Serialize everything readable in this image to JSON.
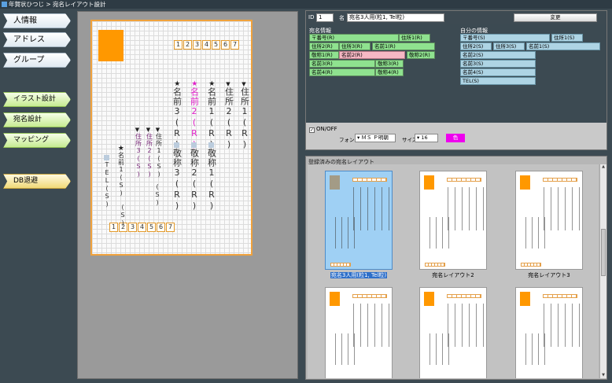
{
  "window": {
    "title": "年賀状ひつじ > 宛名レイアウト設計"
  },
  "nav": [
    {
      "label": "人情報",
      "style": "blue"
    },
    {
      "label": "アドレス",
      "style": "blue"
    },
    {
      "label": "グループ",
      "style": "blue"
    },
    {
      "label": "イラスト設計",
      "style": "green"
    },
    {
      "label": "宛名設計",
      "style": "green"
    },
    {
      "label": "マッピング",
      "style": "green"
    },
    {
      "label": "DB退避",
      "style": "yellow"
    }
  ],
  "card": {
    "postal_top": [
      "1",
      "2",
      "3",
      "4",
      "5",
      "6",
      "7"
    ],
    "postal_bottom": [
      "1",
      "2",
      "3",
      "4",
      "5",
      "6",
      "7"
    ],
    "columns_large": [
      {
        "text": "名前3(R)",
        "mark": "star"
      },
      {
        "text": "名前2(R)",
        "mark": "star-pink"
      },
      {
        "text": "名前1(R)",
        "mark": "star"
      },
      {
        "text": "住所2(R)",
        "mark": "tri"
      },
      {
        "text": "住所1(R)",
        "mark": "tri"
      }
    ],
    "columns_honor": [
      "敬称3(R)",
      "敬称2(R)",
      "敬称1(R)"
    ],
    "columns_small": [
      {
        "text": "TEL(S)",
        "mark": "sq"
      },
      {
        "text": "名前1(S)",
        "mark": "star"
      },
      {
        "text": "住所3(S)",
        "mark": "tri"
      },
      {
        "text": "住所2(S)",
        "mark": "tri"
      },
      {
        "text": "住所1(S)",
        "mark": "tri"
      }
    ],
    "small_extra": "(S)",
    "small_extra2": "(S)"
  },
  "toolbar": {
    "id_label": "ID",
    "id_value": "1",
    "name_label": "名",
    "name_value": "宛名3人用(粒1, Tel粒)",
    "change_button": "変更"
  },
  "recipient_group": {
    "title": "宛名情報",
    "fields": [
      {
        "label": "〒番号(R)",
        "style": "g"
      },
      {
        "label": "住所1(R)",
        "style": "g"
      },
      {
        "label": "住所2(R)",
        "style": "g"
      },
      {
        "label": "住所3(R)",
        "style": "g"
      },
      {
        "label": "名前1(R)",
        "style": "g"
      },
      {
        "label": "敬称1(R)",
        "style": "g"
      },
      {
        "label": "名前2(R)",
        "style": "p"
      },
      {
        "label": "敬称2(R)",
        "style": "g"
      },
      {
        "label": "名前3(R)",
        "style": "g"
      },
      {
        "label": "敬称3(R)",
        "style": "g"
      },
      {
        "label": "名前4(R)",
        "style": "g"
      },
      {
        "label": "敬称4(R)",
        "style": "g"
      }
    ]
  },
  "sender_group": {
    "title": "自分の情報",
    "fields": [
      {
        "label": "〒番号(S)",
        "style": "b"
      },
      {
        "label": "住所1(S)",
        "style": "b"
      },
      {
        "label": "住所2(S)",
        "style": "b"
      },
      {
        "label": "住所3(S)",
        "style": "b"
      },
      {
        "label": "名前1(S)",
        "style": "b"
      },
      {
        "label": "名前2(S)",
        "style": "b"
      },
      {
        "label": "名前3(S)",
        "style": "b"
      },
      {
        "label": "名前4(S)",
        "style": "b"
      },
      {
        "label": "TEL(S)",
        "style": "b"
      }
    ]
  },
  "options": {
    "onoff_label": "ON/OFF",
    "font_label": "フォント",
    "font_value": "ＭＳ Ｐ明朝",
    "size_label": "サイズ",
    "size_value": "16",
    "color_label": "色",
    "color": "#ee00ee"
  },
  "layouts": {
    "title": "登録済みの宛名レイアウト",
    "items": [
      {
        "caption": "宛名3人用(粒1, Tel粒)",
        "selected": true
      },
      {
        "caption": "宛名レイアウト2",
        "selected": false
      },
      {
        "caption": "宛名レイアウト3",
        "selected": false
      },
      {
        "caption": "",
        "selected": false
      },
      {
        "caption": "",
        "selected": false
      },
      {
        "caption": "",
        "selected": false
      }
    ]
  },
  "colors": {
    "accent_orange": "#ff9800",
    "field_green": "#8fe28f",
    "field_blue": "#aed4e4",
    "field_pink": "#f6b8c4"
  }
}
